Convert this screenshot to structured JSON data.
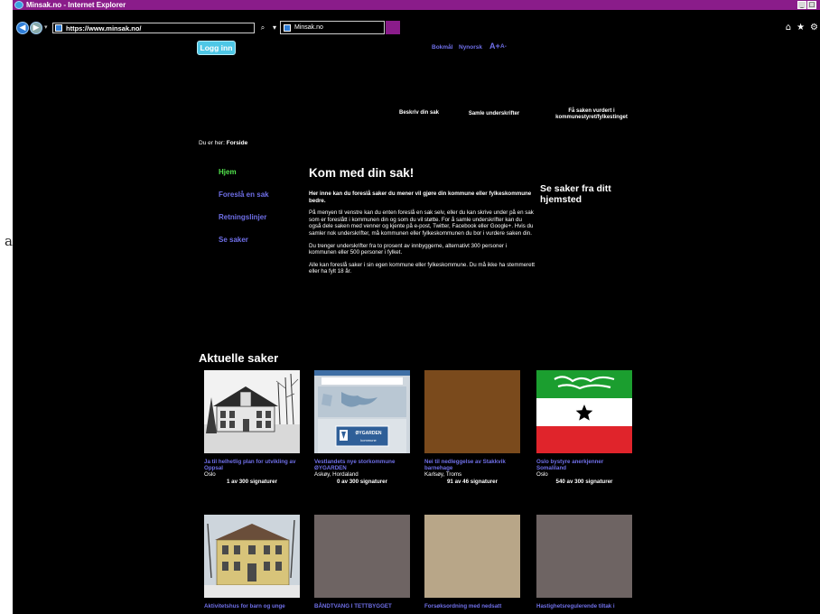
{
  "window": {
    "title": "Minsak.no - Internet Explorer"
  },
  "browser": {
    "url": "https://www.minsak.no/",
    "tab_title": "Minsak.no"
  },
  "side_glyph": "a",
  "header": {
    "login_label": "Logg inn",
    "lang_bokmal": "Bokmål",
    "lang_nynorsk": "Nynorsk",
    "font_increase": "A+",
    "font_decrease": "A-"
  },
  "steps": [
    {
      "label": "Beskriv din sak"
    },
    {
      "label": "Samle underskrifter"
    },
    {
      "label": "Få saken vurdert i kommunestyret/fylkestinget"
    }
  ],
  "breadcrumb": {
    "prefix": "Du er her:",
    "current": "Forside"
  },
  "menu": [
    {
      "label": "Hjem",
      "active": true
    },
    {
      "label": "Foreslå en sak",
      "active": false
    },
    {
      "label": "Retningslinjer",
      "active": false
    },
    {
      "label": "Se saker",
      "active": false
    }
  ],
  "main": {
    "headline": "Kom med din sak!",
    "lead": "Her inne kan du foreslå saker du mener vil gjøre din kommune eller fylkeskommune bedre.",
    "para1": "På menyen til venstre kan du enten foreslå en sak selv, eller du kan skrive under på en sak som er foreslått i kommunen din og som du vil støtte. For å samle underskrifter kan du også dele saken med venner og kjente på e-post, Twitter, Facebook eller Google+. Hvis du samler nok underskrifter, må kommunen eller fylkeskommunen du bor i vurdere saken din.",
    "para2": "Du trenger underskrifter fra to prosent av innbyggerne, alternativt 300 personer i kommunen eller 500 personer i fylket.",
    "para3": "Alle kan foreslå saker i sin egen kommune eller fylkeskommune. Du må ikke ha stemmerett eller ha fylt 18 år."
  },
  "hjemsted": {
    "heading": "Se saker fra ditt hjemsted"
  },
  "aktuelle": {
    "heading": "Aktuelle saker",
    "cards": [
      {
        "title": "Ja til helhetlig plan for utvikling av Oppsal",
        "place": "Oslo",
        "signatures": "1 av 300 signaturer",
        "image": "house-photo"
      },
      {
        "title": "Vestlandets nye storkommune ØYGARDEN",
        "place": "Askøy, Hordaland",
        "signatures": "0 av 300 signaturer",
        "image": "map-screenshot",
        "image_text": "ØYGARDEN",
        "image_subtext": "kommune"
      },
      {
        "title": "Nei til nedleggelse av Stakkvik barnehage",
        "place": "Karlsøy, Troms",
        "signatures": "91 av 46 signaturer",
        "image": "plain-brown",
        "color": "#7a4a1c"
      },
      {
        "title": "Oslo bystyre anerkjenner Somaliland",
        "place": "Oslo",
        "signatures": "540 av 300 signaturer",
        "image": "flag",
        "colors": [
          "#1b9e2f",
          "#ffffff",
          "#e0242b"
        ]
      },
      {
        "title": "Aktivitetshus for barn og unge",
        "place": "",
        "signatures": "",
        "image": "yellow-house"
      },
      {
        "title": "BÅNDTVANG I TETTBYGGET",
        "place": "",
        "signatures": "",
        "image": "plain-gray",
        "color": "#6e6463"
      },
      {
        "title": "Forsøksordning med nedsatt",
        "place": "",
        "signatures": "",
        "image": "plain-beige",
        "color": "#b8a688"
      },
      {
        "title": "Hastighetsregulerende tiltak i",
        "place": "",
        "signatures": "",
        "image": "plain-gray2",
        "color": "#6e6463"
      }
    ]
  }
}
